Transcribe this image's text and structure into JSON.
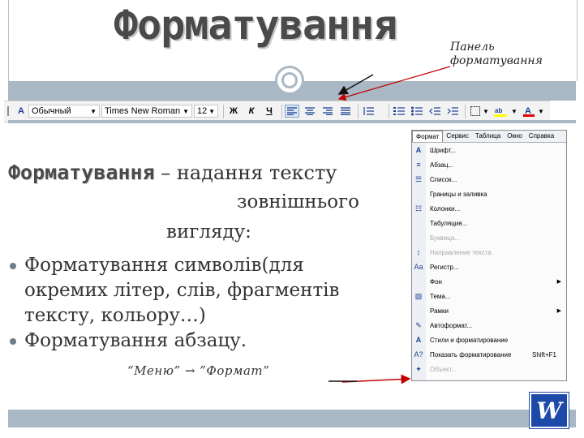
{
  "slide": {
    "title": "Форматування",
    "panel_note_line1": "Панель",
    "panel_note_line2": "форматування"
  },
  "toolbar": {
    "style_value": "Обычный",
    "font_value": "Times New Roman",
    "size_value": "12",
    "bold_label": "Ж",
    "italic_label": "К",
    "underline_label": "Ч"
  },
  "menu": {
    "bar": [
      "Формат",
      "Сервис",
      "Таблица",
      "Окно",
      "Справка"
    ],
    "items": [
      {
        "label": "Шрифт...",
        "icon": "font-icon"
      },
      {
        "label": "Абзац...",
        "icon": "paragraph-icon"
      },
      {
        "label": "Список...",
        "icon": "list-icon"
      },
      {
        "label": "Границы и заливка",
        "icon": ""
      },
      {
        "label": "Колонки...",
        "icon": "columns-icon"
      },
      {
        "label": "Табуляция...",
        "icon": ""
      },
      {
        "label": "Буквица...",
        "icon": ""
      },
      {
        "label": "Направление текста",
        "icon": ""
      },
      {
        "label": "Регистр...",
        "icon": ""
      },
      {
        "label": "Фон",
        "icon": ""
      },
      {
        "label": "Тема...",
        "icon": ""
      },
      {
        "label": "Рамки",
        "icon": ""
      },
      {
        "label": "Автоформат...",
        "icon": ""
      },
      {
        "label": "Стили и форматирование",
        "icon": ""
      },
      {
        "label": "Показать форматирование",
        "icon": "",
        "shortcut": "Shift+F1"
      },
      {
        "label": "Объект...",
        "icon": ""
      }
    ]
  },
  "content": {
    "def_term": "Форматування",
    "def_rest": " – надання тексту",
    "def_line2": "зовнішнього",
    "def_line3": "вигляду:",
    "bullets": [
      "Форматування символів(для окремих літер, слів, фрагментів тексту, кольору…)",
      "Форматування абзацу."
    ],
    "path": "“Меню” → ”Формат”"
  },
  "logo": {
    "letter": "W"
  },
  "colors": {
    "band": "#a9b8c4",
    "accent_red": "#c00000",
    "word_blue": "#1d4aa8"
  }
}
